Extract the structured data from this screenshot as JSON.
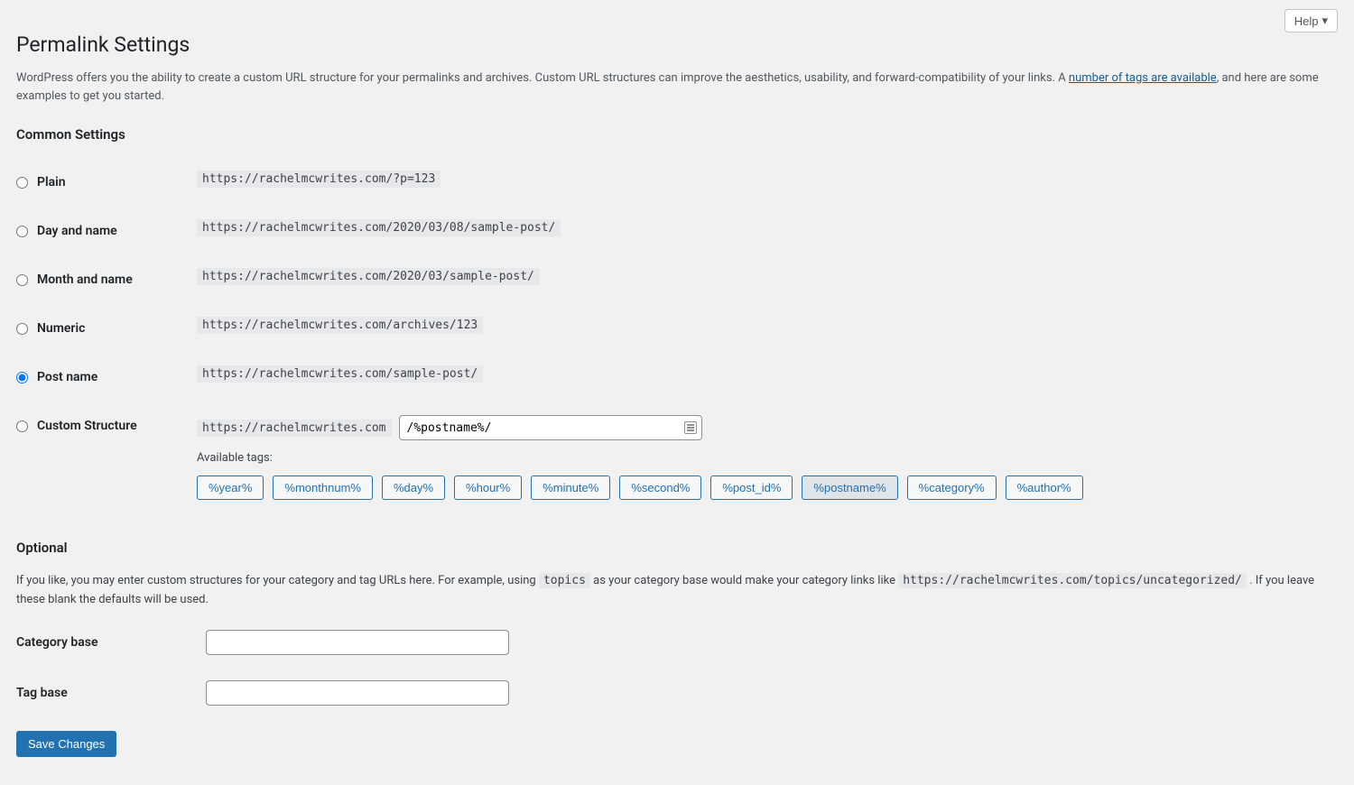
{
  "help_btn": "Help",
  "page_title": "Permalink Settings",
  "intro_pre": "WordPress offers you the ability to create a custom URL structure for your permalinks and archives. Custom URL structures can improve the aesthetics, usability, and forward-compatibility of your links. A ",
  "intro_link": "number of tags are available",
  "intro_post": ", and here are some examples to get you started.",
  "common_heading": "Common Settings",
  "settings": [
    {
      "label": "Plain",
      "example": "https://rachelmcwrites.com/?p=123",
      "checked": false
    },
    {
      "label": "Day and name",
      "example": "https://rachelmcwrites.com/2020/03/08/sample-post/",
      "checked": false
    },
    {
      "label": "Month and name",
      "example": "https://rachelmcwrites.com/2020/03/sample-post/",
      "checked": false
    },
    {
      "label": "Numeric",
      "example": "https://rachelmcwrites.com/archives/123",
      "checked": false
    },
    {
      "label": "Post name",
      "example": "https://rachelmcwrites.com/sample-post/",
      "checked": true
    }
  ],
  "custom_label": "Custom Structure",
  "custom_prefix": "https://rachelmcwrites.com",
  "custom_value": "/%postname%/",
  "available_tags_label": "Available tags:",
  "tags": [
    {
      "text": "%year%",
      "pressed": false
    },
    {
      "text": "%monthnum%",
      "pressed": false
    },
    {
      "text": "%day%",
      "pressed": false
    },
    {
      "text": "%hour%",
      "pressed": false
    },
    {
      "text": "%minute%",
      "pressed": false
    },
    {
      "text": "%second%",
      "pressed": false
    },
    {
      "text": "%post_id%",
      "pressed": false
    },
    {
      "text": "%postname%",
      "pressed": true
    },
    {
      "text": "%category%",
      "pressed": false
    },
    {
      "text": "%author%",
      "pressed": false
    }
  ],
  "optional_heading": "Optional",
  "optional_pre": "If you like, you may enter custom structures for your category and tag URLs here. For example, using ",
  "optional_code1": "topics",
  "optional_mid": " as your category base would make your category links like ",
  "optional_code2": "https://rachelmcwrites.com/topics/uncategorized/",
  "optional_post": " . If you leave these blank the defaults will be used.",
  "category_base_label": "Category base",
  "category_base_value": "",
  "tag_base_label": "Tag base",
  "tag_base_value": "",
  "save_label": "Save Changes"
}
